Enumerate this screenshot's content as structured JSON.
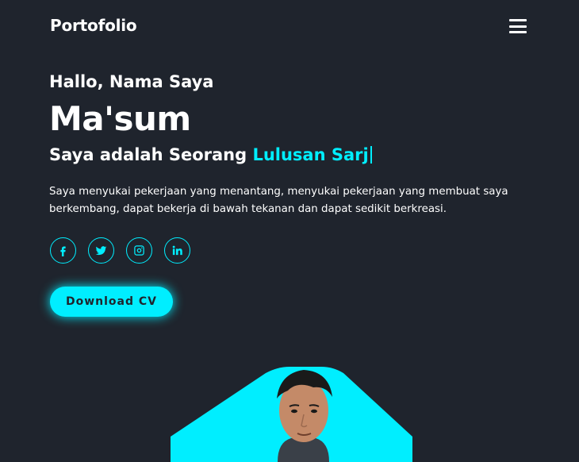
{
  "header": {
    "logo": "Portofolio",
    "menu_icon": "hamburger-icon"
  },
  "hero": {
    "greeting": "Hallo, Nama Saya",
    "name": "Ma'sum",
    "role_prefix": "Saya adalah Seorang",
    "role_highlight": "Lulusan Sarj",
    "description": "Saya menyukai pekerjaan yang menantang, menyukai pekerjaan yang membuat saya berkembang, dapat bekerja di bawah tekanan dan dapat sedikit berkreasi.",
    "social": [
      {
        "name": "facebook-icon"
      },
      {
        "name": "twitter-icon"
      },
      {
        "name": "instagram-icon"
      },
      {
        "name": "linkedin-icon"
      }
    ],
    "cta_label": "Download CV"
  },
  "colors": {
    "background": "#1f242d",
    "accent": "#00eeff",
    "text": "#ffffff"
  }
}
